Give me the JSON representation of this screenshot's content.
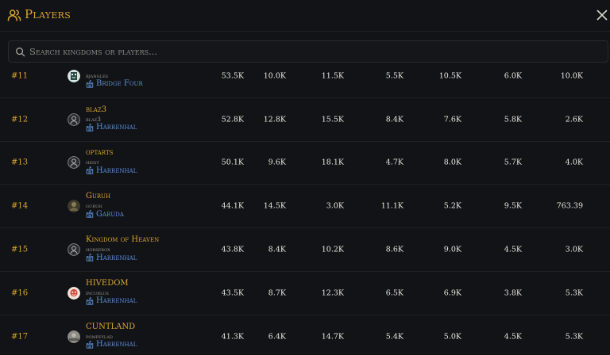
{
  "header": {
    "title": "Players",
    "icon": "users-icon",
    "accent_color": "#d9a52c",
    "close_icon": "close-icon"
  },
  "search": {
    "placeholder": "Search kingdoms or players...",
    "value": "",
    "icon": "search-icon"
  },
  "rows": [
    {
      "rank": "#11",
      "name": "",
      "handle": "bjangles",
      "kingdom": "Bridge Four",
      "avatar": "pixel",
      "stats": [
        "53.5K",
        "10.0K",
        "11.5K",
        "5.5K",
        "10.5K",
        "6.0K",
        "10.0K"
      ]
    },
    {
      "rank": "#12",
      "name": "blaz3",
      "handle": "blaz3",
      "kingdom": "Harrenhal",
      "avatar": "default",
      "stats": [
        "52.8K",
        "12.8K",
        "15.5K",
        "8.4K",
        "7.6K",
        "5.8K",
        "2.6K"
      ]
    },
    {
      "rank": "#13",
      "name": "optarts",
      "handle": "heist",
      "kingdom": "Harrenhal",
      "avatar": "default",
      "stats": [
        "50.1K",
        "9.6K",
        "18.1K",
        "4.7K",
        "8.0K",
        "5.7K",
        "4.0K"
      ]
    },
    {
      "rank": "#14",
      "name": "Guruh",
      "handle": "guruh",
      "kingdom": "Garuda",
      "avatar": "photo",
      "stats": [
        "44.1K",
        "14.5K",
        "3.0K",
        "11.1K",
        "5.2K",
        "9.5K",
        "763.39"
      ]
    },
    {
      "rank": "#15",
      "name": "Kingdom of Heaven",
      "handle": "horsebox",
      "kingdom": "Harrenhal",
      "avatar": "default",
      "stats": [
        "43.8K",
        "8.4K",
        "10.2K",
        "8.6K",
        "9.0K",
        "4.5K",
        "3.0K"
      ]
    },
    {
      "rank": "#16",
      "name": "HIVEDOM",
      "handle": "incublus",
      "kingdom": "Harrenhal",
      "avatar": "red",
      "stats": [
        "43.5K",
        "8.7K",
        "12.3K",
        "6.5K",
        "6.9K",
        "3.8K",
        "5.3K"
      ]
    },
    {
      "rank": "#17",
      "name": "CUNTLAND",
      "handle": "pompeylad",
      "kingdom": "Harrenhal",
      "avatar": "grey",
      "stats": [
        "41.3K",
        "6.4K",
        "14.7K",
        "5.4K",
        "5.0K",
        "4.5K",
        "5.3K"
      ]
    }
  ]
}
